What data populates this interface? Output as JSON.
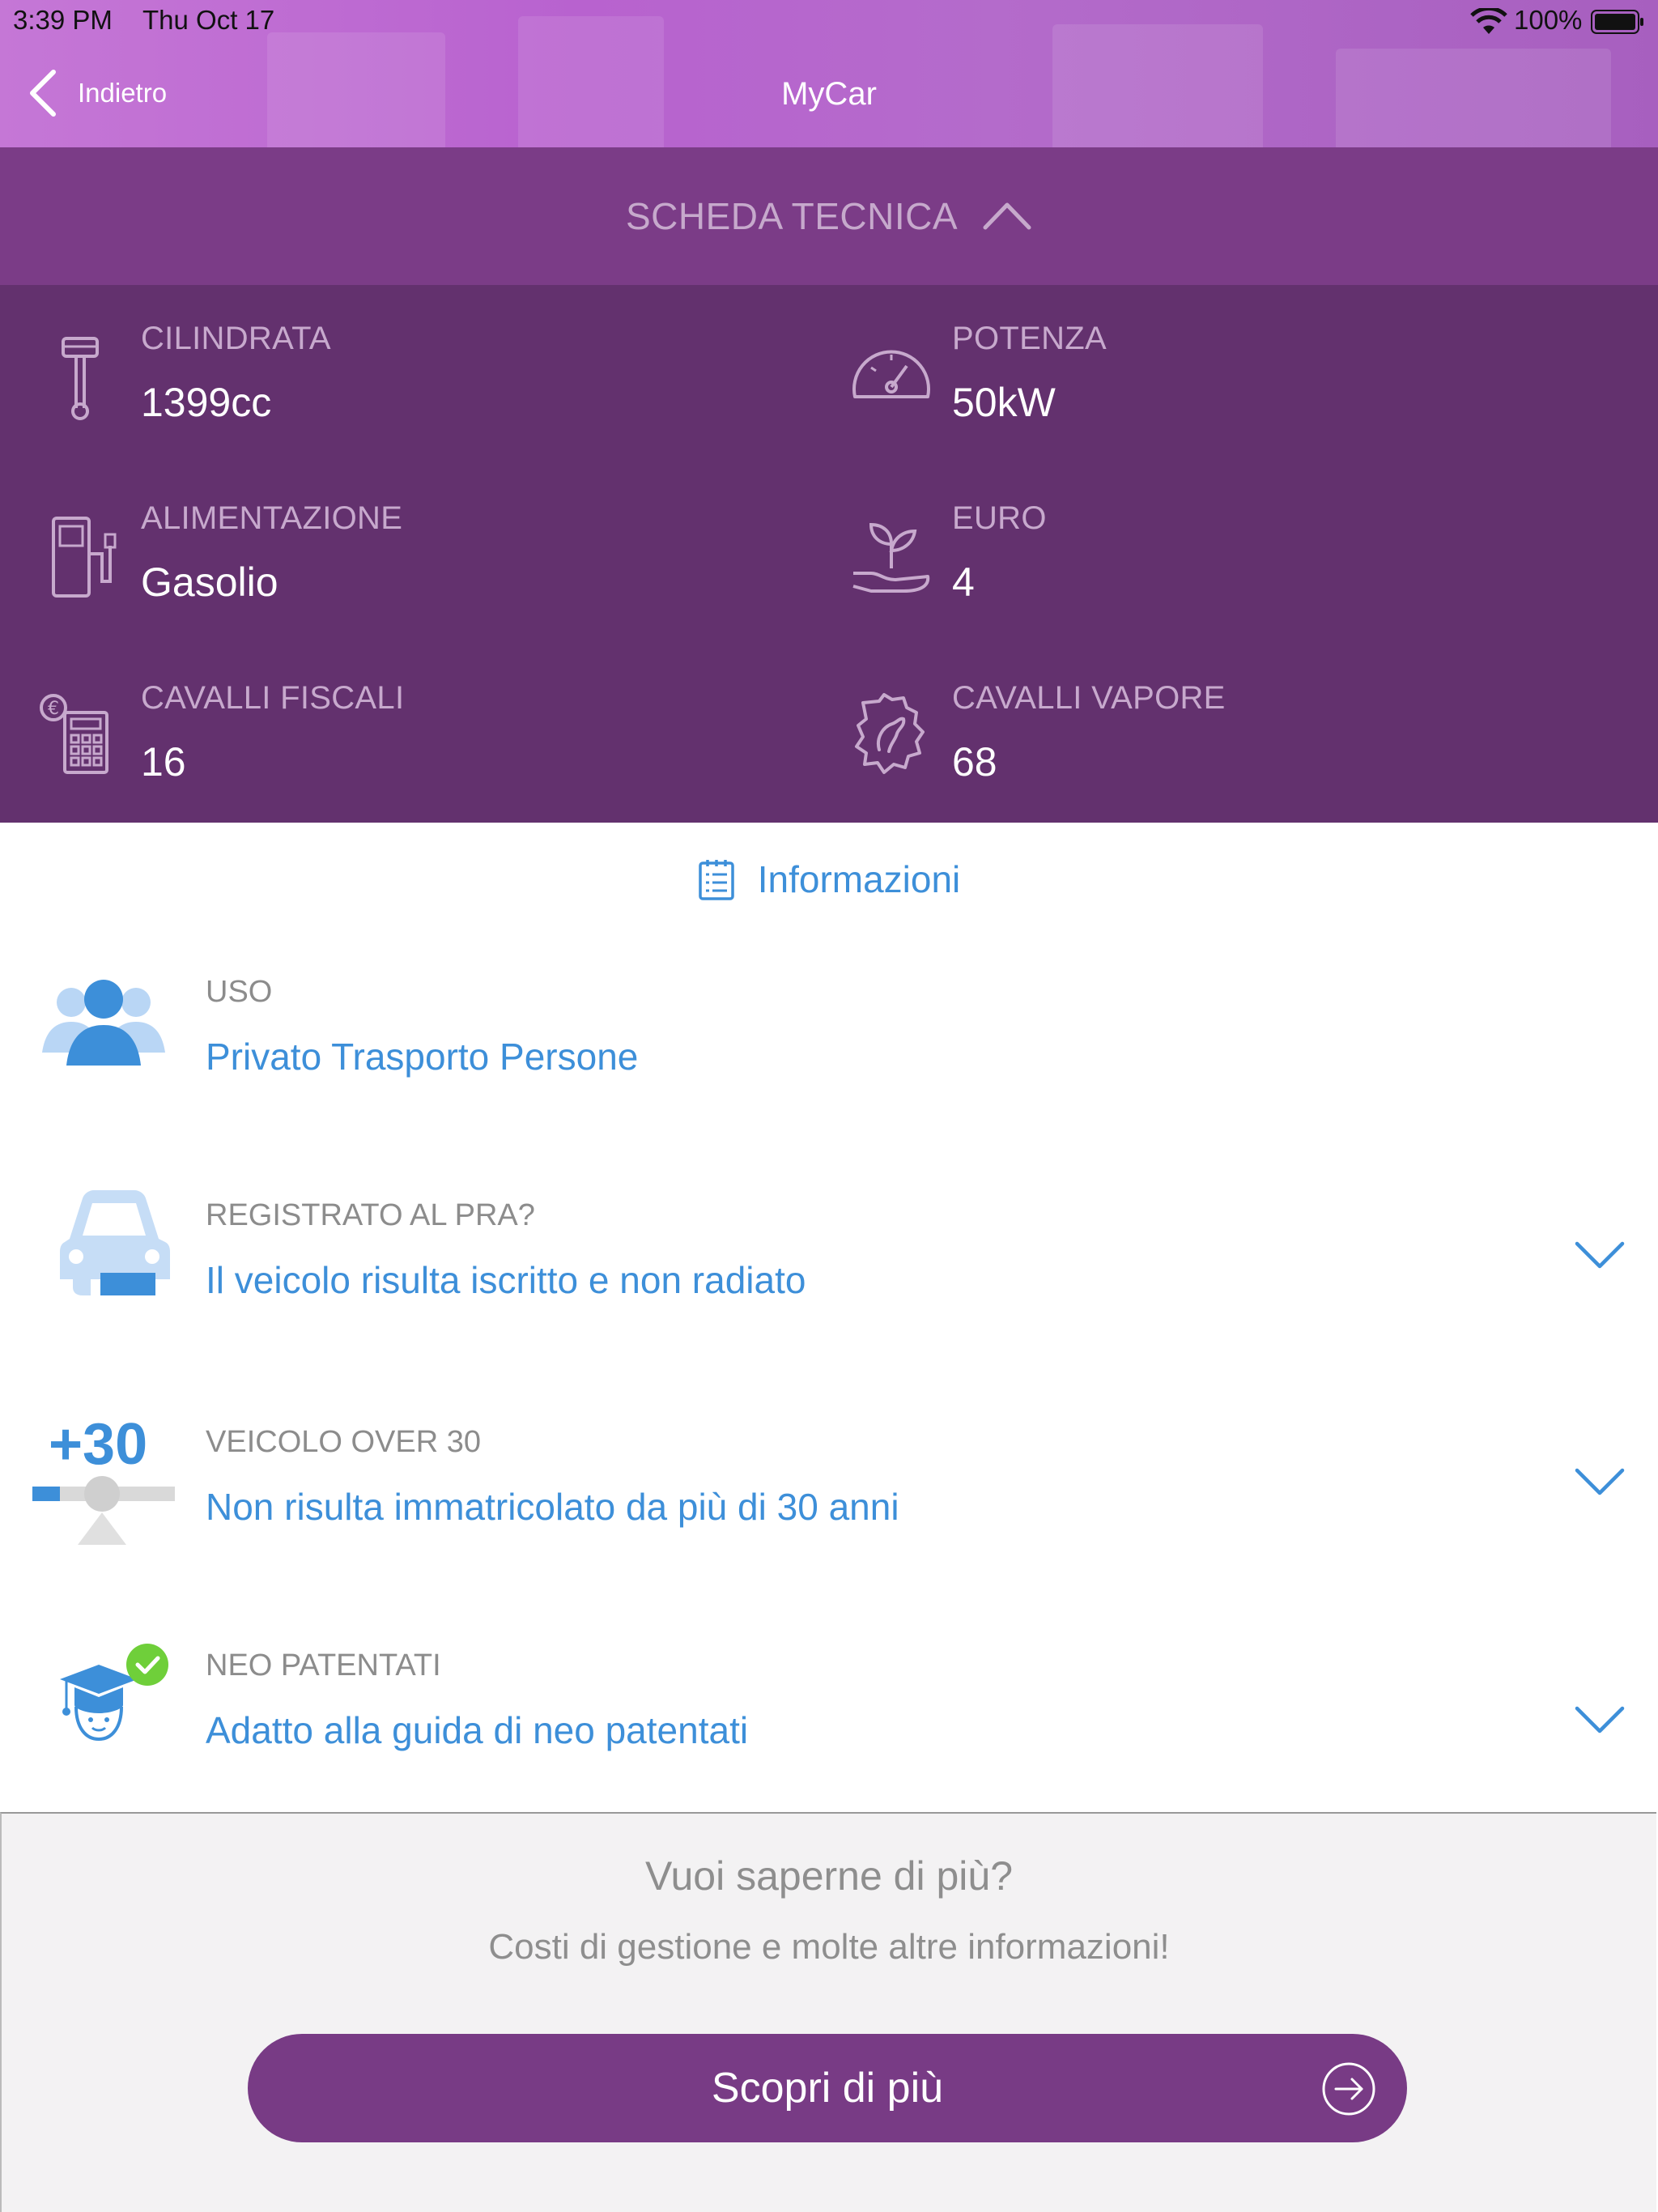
{
  "status_bar": {
    "time": "3:39 PM",
    "date": "Thu Oct 17",
    "battery": "100%"
  },
  "nav": {
    "back_label": "Indietro",
    "title": "MyCar"
  },
  "scheda": {
    "title": "SCHEDA TECNICA"
  },
  "specs": [
    {
      "label": "CILINDRATA",
      "value": "1399cc",
      "icon": "piston-icon"
    },
    {
      "label": "POTENZA",
      "value": "50kW",
      "icon": "speedometer-icon"
    },
    {
      "label": "ALIMENTAZIONE",
      "value": "Gasolio",
      "icon": "fuel-pump-icon"
    },
    {
      "label": "EURO",
      "value": "4",
      "icon": "plant-hand-icon"
    },
    {
      "label": "CAVALLI FISCALI",
      "value": "16",
      "icon": "calculator-euro-icon"
    },
    {
      "label": "CAVALLI VAPORE",
      "value": "68",
      "icon": "horse-gear-icon"
    }
  ],
  "info": {
    "title": "Informazioni",
    "rows": [
      {
        "label": "USO",
        "value": "Privato Trasporto Persone",
        "icon": "people-icon"
      },
      {
        "label": "REGISTRATO AL PRA?",
        "value": "Il veicolo risulta iscritto e non radiato",
        "icon": "car-icon"
      },
      {
        "label": "VEICOLO OVER 30",
        "value": "Non risulta immatricolato da più di 30 anni",
        "icon": "over-30-icon",
        "badge": "+30"
      },
      {
        "label": "NEO PATENTATI",
        "value": "Adatto alla guida di neo patentati",
        "icon": "graduate-icon"
      }
    ]
  },
  "more": {
    "title": "Vuoi saperne di più?",
    "subtitle": "Costi di gestione e molte altre informazioni!",
    "button": "Scopri di più"
  },
  "colors": {
    "header": "#b862cf",
    "scheda_bar": "#7b3c87",
    "specs_bg": "#63316e",
    "accent_blue": "#3d8fd9",
    "cta": "#783b85",
    "check_green": "#6fcf3a"
  }
}
